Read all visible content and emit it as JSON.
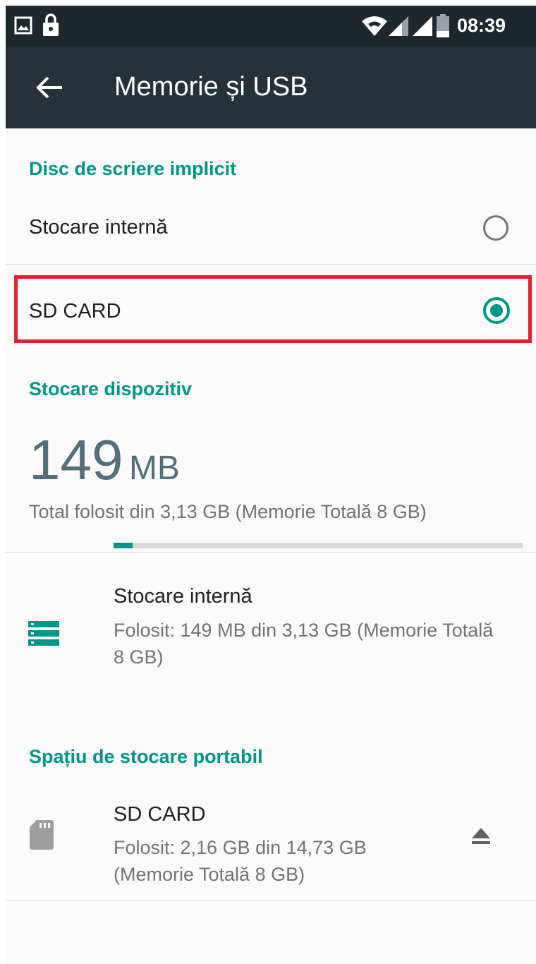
{
  "status_bar": {
    "time": "08:39",
    "icons": [
      "image-icon",
      "lock-icon",
      "wifi-icon",
      "signal-icon",
      "signal-icon",
      "battery-icon"
    ]
  },
  "app_bar": {
    "title": "Memorie și USB",
    "back_icon": "arrow-back-icon"
  },
  "default_write_disk": {
    "header": "Disc de scriere implicit",
    "options": [
      {
        "label": "Stocare internă",
        "selected": false
      },
      {
        "label": "SD CARD",
        "selected": true
      }
    ]
  },
  "device_storage": {
    "header": "Stocare dispozitiv",
    "used_value": "149",
    "used_unit": "MB",
    "summary": "Total folosit din 3,13 GB (Memorie Totală 8 GB)",
    "items": [
      {
        "title": "Stocare internă",
        "subtitle": "Folosit: 149 MB din 3,13 GB (Memorie Totală 8 GB)",
        "icon": "storage-icon",
        "progress": 0.0465
      }
    ]
  },
  "portable_storage": {
    "header": "Spațiu de stocare portabil",
    "items": [
      {
        "title": "SD CARD",
        "subtitle": "Folosit: 2,16 GB din 14,73 GB (Memorie Totală 8 GB)",
        "icon": "sd-card-icon",
        "action_icon": "eject-icon"
      }
    ]
  },
  "colors": {
    "accent": "#009688",
    "app_bar": "#263238",
    "status_bar": "#1e282c",
    "highlight": "#e0212e"
  }
}
